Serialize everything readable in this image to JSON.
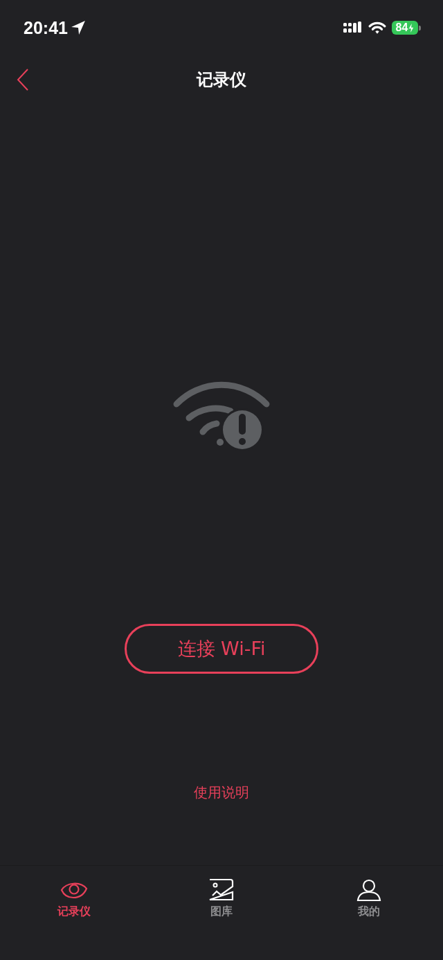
{
  "status_bar": {
    "time": "20:41",
    "battery": "84"
  },
  "nav": {
    "title": "记录仪"
  },
  "main": {
    "connect_button": "连接 Wi-Fi",
    "help_link": "使用说明"
  },
  "tab_bar": {
    "tabs": [
      {
        "label": "记录仪",
        "selected": true
      },
      {
        "label": "图库",
        "selected": false
      },
      {
        "label": "我的",
        "selected": false
      }
    ]
  }
}
